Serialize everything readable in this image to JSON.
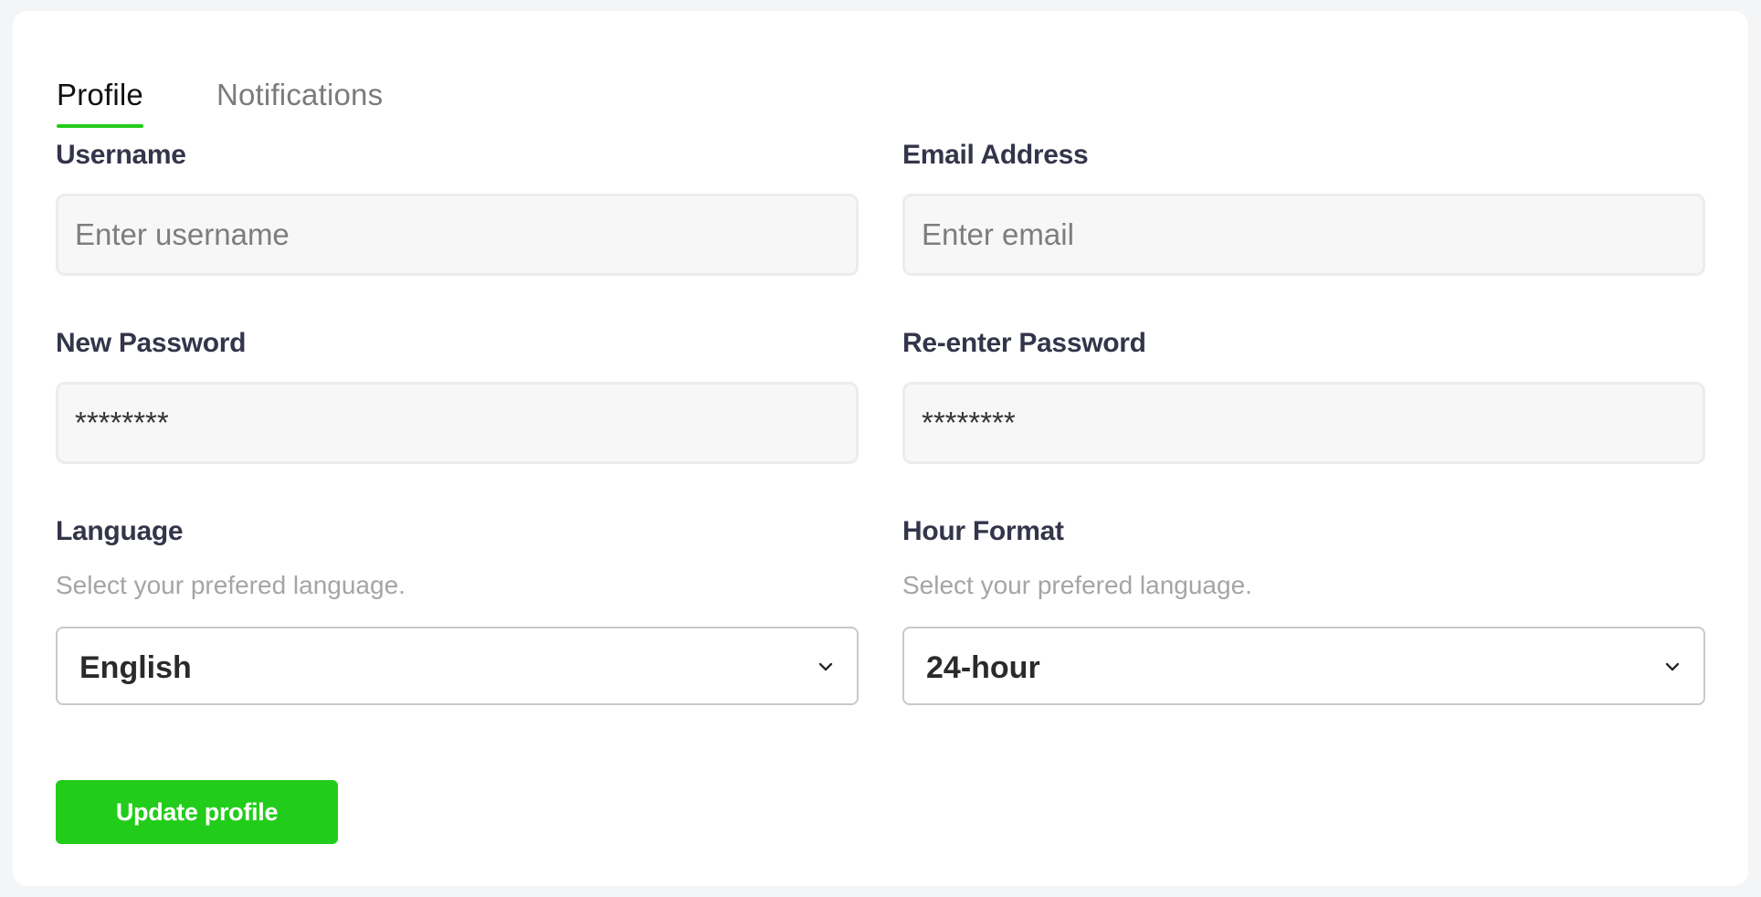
{
  "tabs": {
    "profile": "Profile",
    "notifications": "Notifications",
    "active": "Profile",
    "accent_color": "#22cc1a"
  },
  "form": {
    "username": {
      "label": "Username",
      "placeholder": "Enter username",
      "value": ""
    },
    "email": {
      "label": "Email Address",
      "placeholder": "Enter email",
      "value": ""
    },
    "new_password": {
      "label": "New Password",
      "value": "********"
    },
    "reenter_password": {
      "label": "Re-enter Password",
      "value": "********"
    },
    "language": {
      "label": "Language",
      "helper": "Select your prefered language.",
      "selected": "English",
      "icon": "chevron-down-icon"
    },
    "hour_format": {
      "label": "Hour Format",
      "helper": "Select your prefered language.",
      "selected": "24-hour",
      "icon": "chevron-down-icon"
    }
  },
  "actions": {
    "update_label": "Update profile",
    "update_color": "#22cc1a"
  }
}
